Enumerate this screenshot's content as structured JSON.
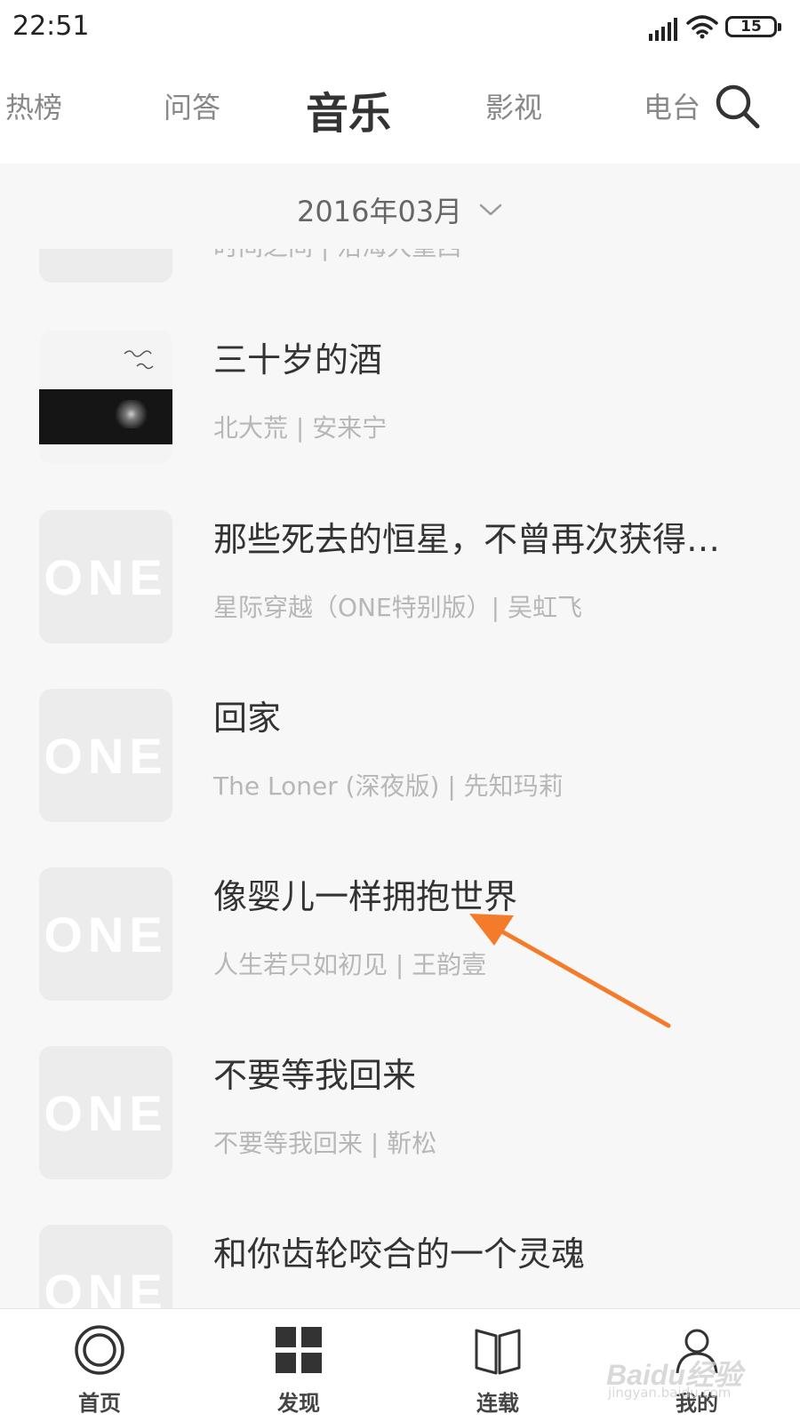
{
  "status_bar": {
    "time": "22:51",
    "battery": "15",
    "icons": [
      "signal-icon",
      "wifi-icon",
      "battery-icon"
    ]
  },
  "top_nav": {
    "tabs": [
      {
        "label": "热榜",
        "active": false
      },
      {
        "label": "问答",
        "active": false
      },
      {
        "label": "音乐",
        "active": true
      },
      {
        "label": "影视",
        "active": false
      },
      {
        "label": "电台",
        "active": false
      }
    ],
    "search_icon": "search-icon"
  },
  "date_selector": {
    "label": "2016年03月",
    "icon": "chevron-down-icon"
  },
  "songs": [
    {
      "title": "",
      "meta": "时间之间 | 沿海大重西",
      "cover": "placeholder"
    },
    {
      "title": "三十岁的酒",
      "meta": "北大荒 | 安来宁",
      "cover": "photo"
    },
    {
      "title": "那些死去的恒星，不曾再次获得…",
      "meta": "星际穿越（ONE特别版）| 吴虹飞",
      "cover": "ONE"
    },
    {
      "title": "回家",
      "meta": "The Loner (深夜版) | 先知玛莉",
      "cover": "ONE"
    },
    {
      "title": "像婴儿一样拥抱世界",
      "meta": "人生若只如初见 | 王韵壹",
      "cover": "ONE"
    },
    {
      "title": "不要等我回来",
      "meta": "不要等我回来 | 靳松",
      "cover": "ONE"
    },
    {
      "title": "和你齿轮咬合的一个灵魂",
      "meta": "",
      "cover": "ONE"
    }
  ],
  "cover_placeholder_text": "ONE",
  "annotation": {
    "type": "arrow",
    "color": "#f47b2a"
  },
  "bottom_nav": [
    {
      "label": "首页",
      "icon": "home-circle-icon"
    },
    {
      "label": "发现",
      "icon": "grid-icon"
    },
    {
      "label": "连载",
      "icon": "book-icon"
    },
    {
      "label": "我的",
      "icon": "user-icon"
    }
  ],
  "watermark": {
    "brand": "Baidu经验",
    "url": "jingyan.baidu.com"
  },
  "colors": {
    "background": "#f7f7f7",
    "title_text": "#333333",
    "meta_text": "#b7b7b7",
    "arrow": "#f47b2a"
  }
}
